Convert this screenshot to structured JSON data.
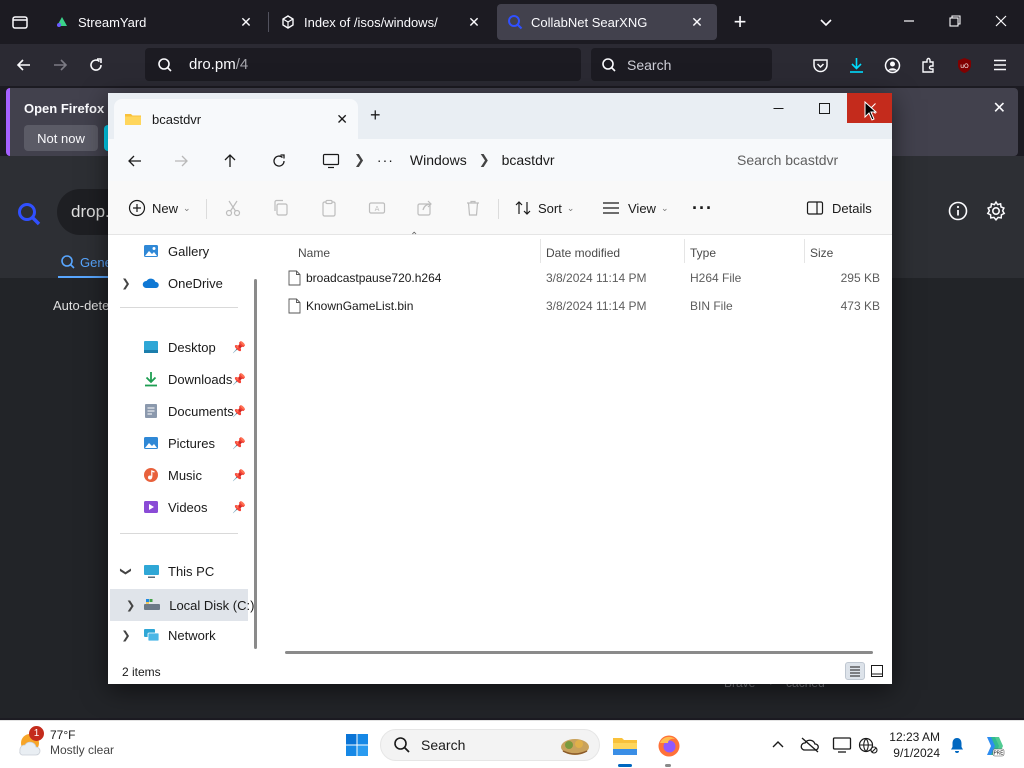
{
  "firefox": {
    "tabs": [
      {
        "title": "StreamYard"
      },
      {
        "title": "Index of /isos/windows/"
      },
      {
        "title": "CollabNet SearXNG"
      }
    ],
    "url_host": "dro.pm",
    "url_path": "/4",
    "search_placeholder": "Search",
    "notification": {
      "text": "Open Firefox ev",
      "not_now": "Not now"
    }
  },
  "searxng": {
    "query": "drop.",
    "tab_label": "Gene",
    "body_text": "Auto-dete",
    "footer_left": "Brave",
    "footer_right": "cached"
  },
  "explorer": {
    "tab_title": "bcastdvr",
    "breadcrumb": [
      "Windows",
      "bcastdvr"
    ],
    "search_placeholder": "Search bcastdvr",
    "commands": {
      "new": "New",
      "sort": "Sort",
      "view": "View",
      "details": "Details"
    },
    "nav": {
      "gallery": "Gallery",
      "onedrive": "OneDrive",
      "quick": [
        {
          "label": "Desktop"
        },
        {
          "label": "Downloads"
        },
        {
          "label": "Documents"
        },
        {
          "label": "Pictures"
        },
        {
          "label": "Music"
        },
        {
          "label": "Videos"
        }
      ],
      "this_pc": "This PC",
      "local_disk": "Local Disk (C:)",
      "network": "Network"
    },
    "columns": {
      "name": "Name",
      "date": "Date modified",
      "type": "Type",
      "size": "Size"
    },
    "files": [
      {
        "name": "broadcastpause720.h264",
        "date": "3/8/2024 11:14 PM",
        "type": "H264 File",
        "size": "295 KB"
      },
      {
        "name": "KnownGameList.bin",
        "date": "3/8/2024 11:14 PM",
        "type": "BIN File",
        "size": "473 KB"
      }
    ],
    "status_count": "2 items"
  },
  "taskbar": {
    "weather_badge": "1",
    "temperature": "77°F",
    "condition": "Mostly clear",
    "search_placeholder": "Search",
    "time": "12:23 AM",
    "date": "9/1/2024"
  },
  "colors": {
    "close_red": "#c42b1c",
    "firefox_dark": "#1c1b22",
    "accent_blue": "#0067c0"
  }
}
